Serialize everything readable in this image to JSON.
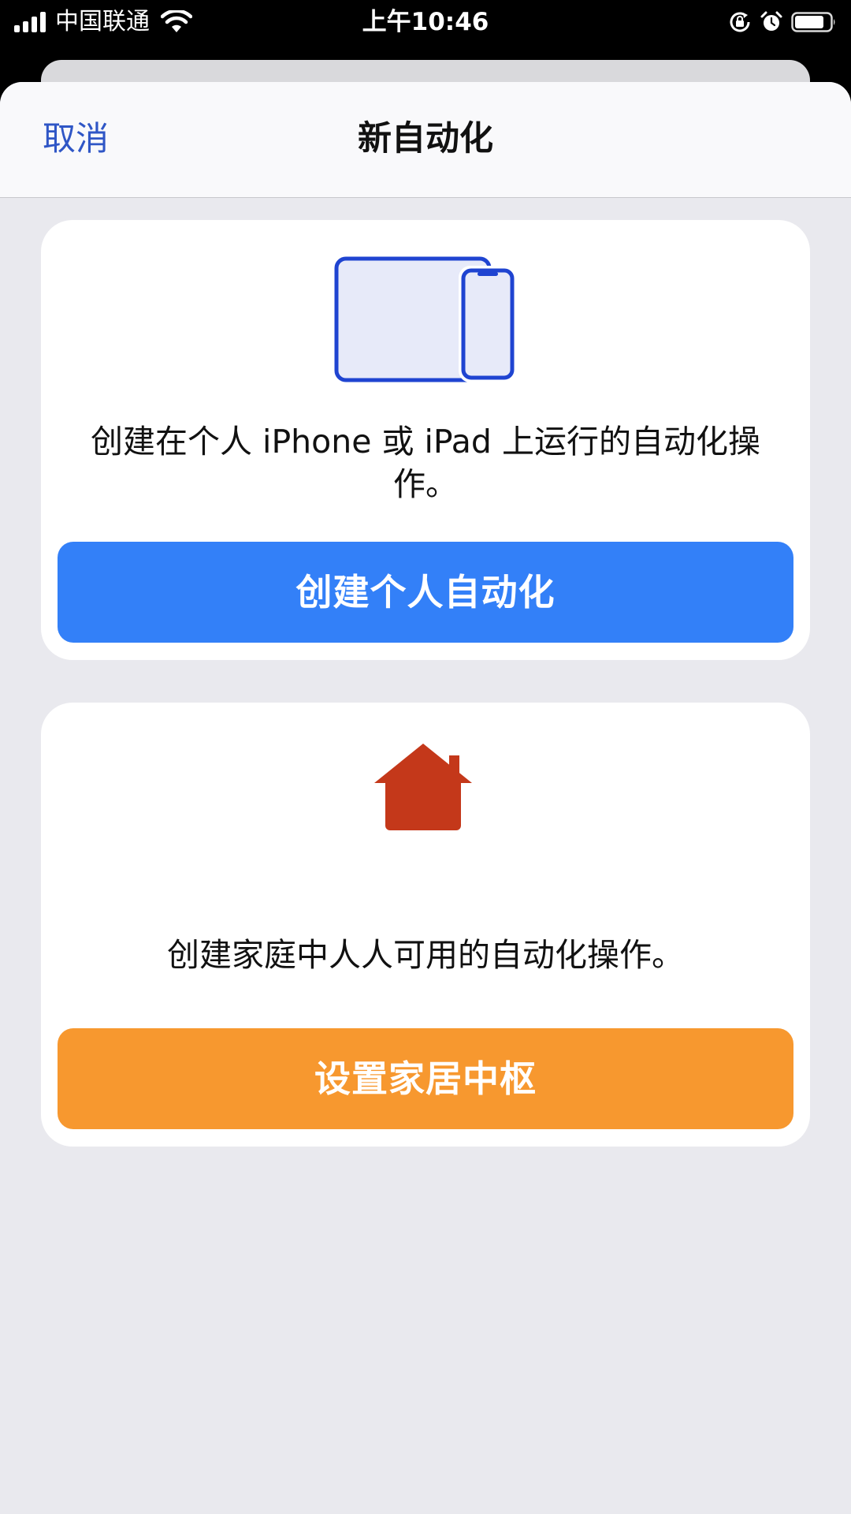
{
  "status_bar": {
    "carrier": "中国联通",
    "time": "上午10:46",
    "icons": [
      "signal-icon",
      "wifi-icon",
      "orientation-lock-icon",
      "alarm-icon",
      "battery-icon"
    ]
  },
  "nav": {
    "cancel_label": "取消",
    "title": "新自动化"
  },
  "personal_card": {
    "icon": "ipad-iphone-icon",
    "description": "创建在个人 iPhone 或 iPad 上运行的自动化操作。",
    "button_label": "创建个人自动化",
    "button_color": "#3380f8"
  },
  "home_card": {
    "icon": "home-icon",
    "description": "创建家庭中人人可用的自动化操作。",
    "button_label": "设置家居中枢",
    "button_color": "#f7982f"
  },
  "colors": {
    "accent": "#2f56c6",
    "home_icon": "#c4381a",
    "background": "#e9e9ee"
  }
}
